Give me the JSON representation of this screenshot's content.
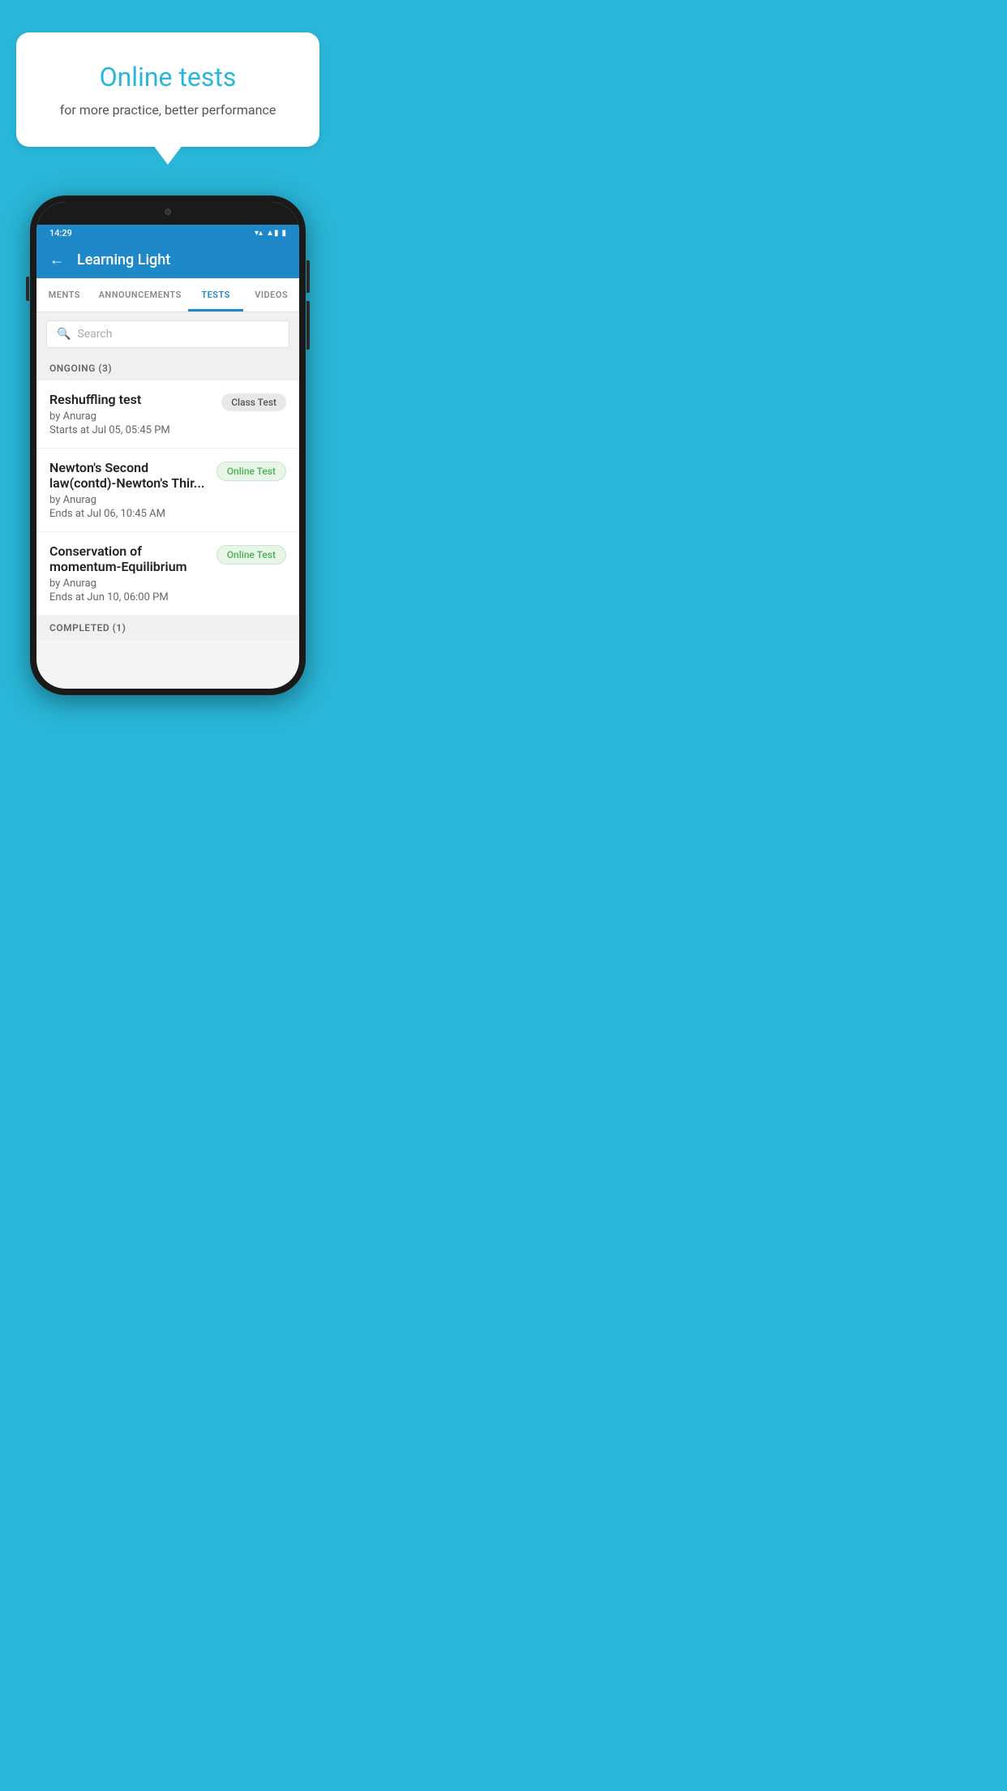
{
  "hero": {
    "bubble_title": "Online tests",
    "bubble_subtitle": "for more practice, better performance"
  },
  "status_bar": {
    "time": "14:29",
    "wifi": "▼",
    "signal": "▲",
    "battery": "▮"
  },
  "app_bar": {
    "title": "Learning Light",
    "back_label": "←"
  },
  "tabs": [
    {
      "label": "MENTS",
      "active": false
    },
    {
      "label": "ANNOUNCEMENTS",
      "active": false
    },
    {
      "label": "TESTS",
      "active": true
    },
    {
      "label": "VIDEOS",
      "active": false
    }
  ],
  "search": {
    "placeholder": "Search"
  },
  "ongoing_section": {
    "header": "ONGOING (3)"
  },
  "tests": [
    {
      "title": "Reshuffling test",
      "by": "by Anurag",
      "time": "Starts at  Jul 05, 05:45 PM",
      "badge": "Class Test",
      "badge_type": "class"
    },
    {
      "title": "Newton's Second law(contd)-Newton's Thir...",
      "by": "by Anurag",
      "time": "Ends at  Jul 06, 10:45 AM",
      "badge": "Online Test",
      "badge_type": "online"
    },
    {
      "title": "Conservation of momentum-Equilibrium",
      "by": "by Anurag",
      "time": "Ends at  Jun 10, 06:00 PM",
      "badge": "Online Test",
      "badge_type": "online"
    }
  ],
  "completed_section": {
    "header": "COMPLETED (1)"
  }
}
